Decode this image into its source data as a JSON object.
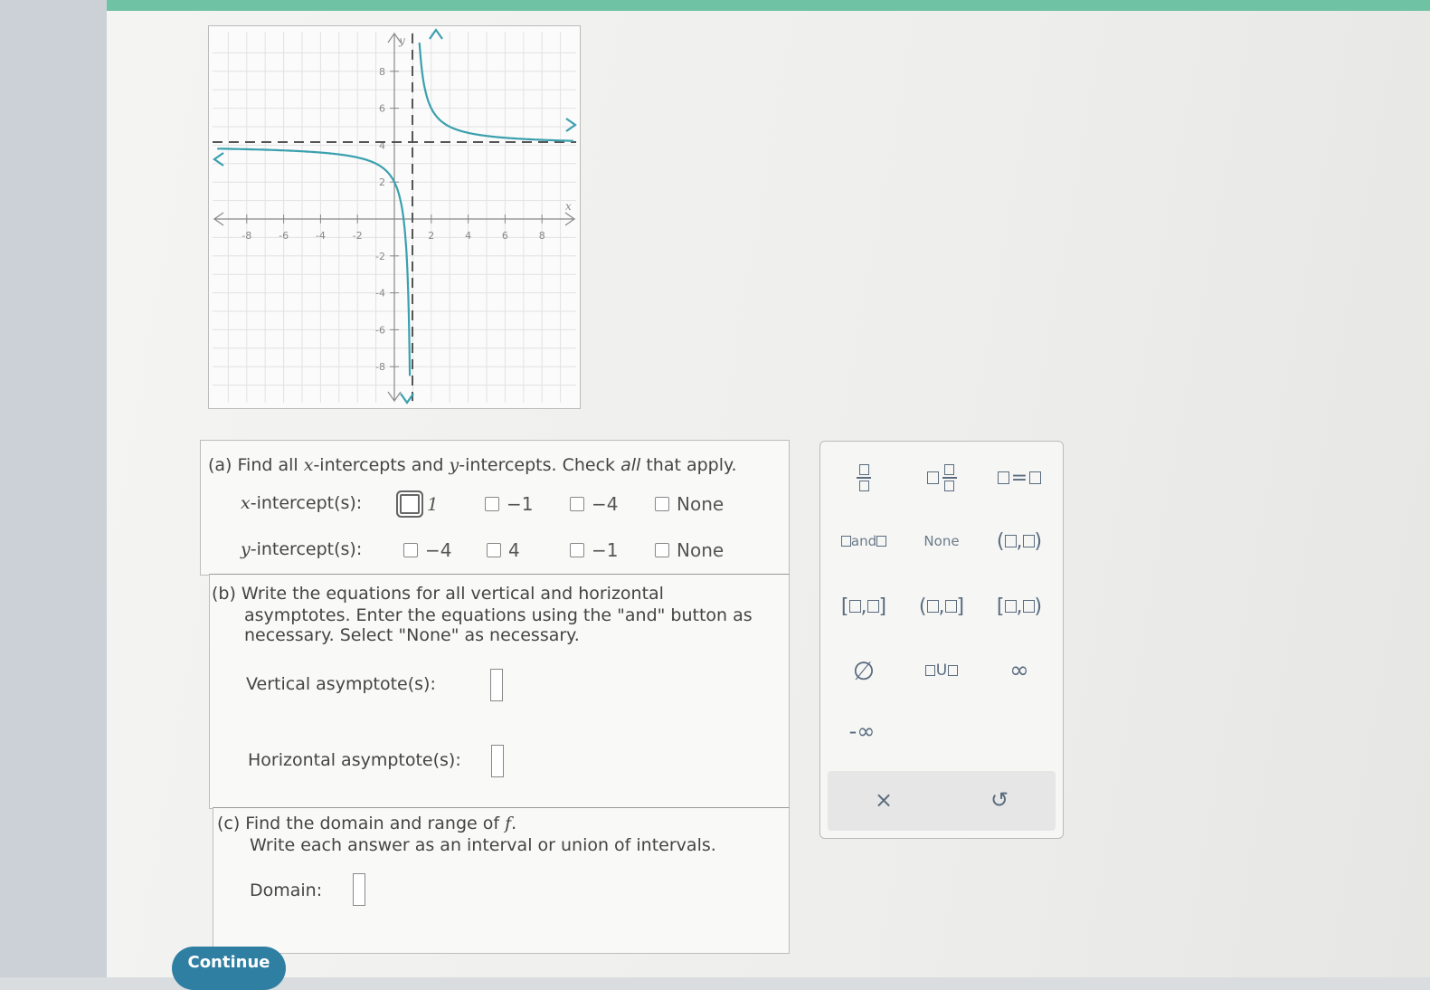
{
  "graph": {
    "x_label": "x",
    "y_label": "y",
    "x_ticks": [
      "-8",
      "-6",
      "-4",
      "-2",
      "2",
      "4",
      "6",
      "8"
    ],
    "y_ticks": [
      "8",
      "6",
      "2",
      "-2",
      "-4",
      "-6",
      "-8"
    ],
    "y_tick_4": "4",
    "colors": {
      "curve": "#3aa0ae",
      "asymptote": "#555555"
    }
  },
  "part_a": {
    "prompt_pre": "(a) Find all ",
    "prompt_x": "x",
    "prompt_mid": "-intercepts and ",
    "prompt_y": "y",
    "prompt_mid2": "-intercepts. Check ",
    "prompt_all": "all",
    "prompt_post": " that apply.",
    "x_row_var": "x",
    "x_row_label": "-intercept(s):",
    "x_options": [
      "1",
      "−1",
      "−4",
      "None"
    ],
    "y_row_var": "y",
    "y_row_label": "-intercept(s):",
    "y_options": [
      "−4",
      "4",
      "−1",
      "None"
    ]
  },
  "part_b": {
    "line1": "(b) Write the equations for all vertical and horizontal",
    "line2": "asymptotes. Enter the equations using the \"and\" button as",
    "line3": "necessary. Select \"None\" as necessary.",
    "vertical_label": "Vertical asymptote(s):",
    "vertical_value": "",
    "horizontal_label": "Horizontal asymptote(s):",
    "horizontal_value": ""
  },
  "part_c": {
    "line1_pre": "(c) Find the domain and range of ",
    "line1_f": "f",
    "line1_post": ".",
    "line2": "Write each answer as an interval or union of intervals.",
    "domain_label": "Domain:",
    "domain_value": ""
  },
  "keypad": {
    "and_text": "and",
    "none_label": "None",
    "empty_set": "∅",
    "union_symbol": "U",
    "infinity": "∞",
    "neg_infinity": "-∞",
    "clear": "×",
    "undo": "↺"
  },
  "continue_label": "Continue"
}
